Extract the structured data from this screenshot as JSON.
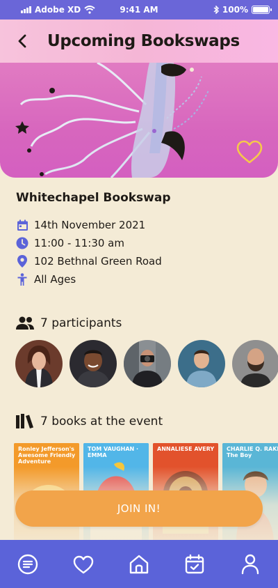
{
  "status": {
    "carrier": "Adobe XD",
    "time": "9:41 AM",
    "battery": "100%",
    "battery_level": 1.0
  },
  "header": {
    "title": "Upcoming Bookswaps",
    "back_icon": "chevron-left-icon"
  },
  "hero": {
    "favorite_icon": "heart-outline-icon",
    "colors": {
      "background": "#d766be",
      "heart": "#f6c94a"
    }
  },
  "event": {
    "title": "Whitechapel Bookswap",
    "date": "14th November 2021",
    "time": "11:00 - 11:30 am",
    "address": "102 Bethnal Green Road",
    "ages": "All Ages",
    "accent_color": "#5b63d9"
  },
  "participants": {
    "label": "7 participants",
    "icon": "people-icon",
    "avatars": [
      {
        "name": "participant-1",
        "bg": "#5a3a2a"
      },
      {
        "name": "participant-2",
        "bg": "#2b2a30"
      },
      {
        "name": "participant-3",
        "bg": "#6a6f74"
      },
      {
        "name": "participant-4",
        "bg": "#3b6e8a"
      },
      {
        "name": "participant-5",
        "bg": "#8a8a8a"
      }
    ]
  },
  "books": {
    "label": "7 books at the event",
    "icon": "books-icon",
    "items": [
      {
        "title": "Ronley Jefferson's Awesome Friendly Adventure",
        "cover": "#f39a2a"
      },
      {
        "title": "TOM VAUGHAN · EMMA",
        "cover": "#52b6e8"
      },
      {
        "title": "ANNALIESE AVERY",
        "cover": "#e2522c"
      },
      {
        "title": "CHARLIE Q. RAKE · The Boy",
        "cover": "#5ab6d6"
      }
    ]
  },
  "cta": {
    "label": "JOIN IN!",
    "color": "#f2a44a"
  },
  "tabbar": {
    "color": "#5b63d9",
    "items": [
      {
        "name": "tab-menu",
        "icon": "menu-circle-icon"
      },
      {
        "name": "tab-favorites",
        "icon": "heart-icon"
      },
      {
        "name": "tab-home",
        "icon": "home-icon"
      },
      {
        "name": "tab-calendar",
        "icon": "calendar-check-icon"
      },
      {
        "name": "tab-profile",
        "icon": "person-icon"
      }
    ]
  }
}
